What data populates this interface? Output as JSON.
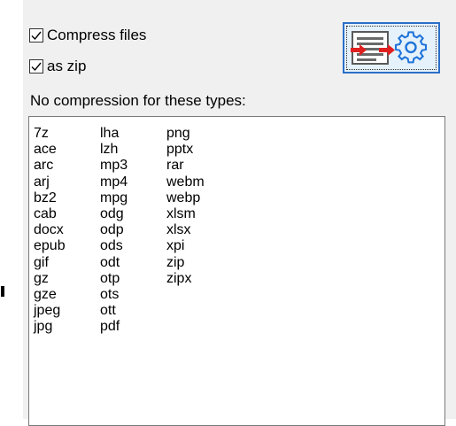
{
  "options": {
    "compress_files": {
      "label": "Compress files",
      "checked": true
    },
    "as_zip": {
      "label": "as zip",
      "checked": true
    }
  },
  "settings_button": {
    "icon": "edit-settings-gear-icon",
    "accent": "#2b6fc8"
  },
  "no_compression": {
    "label": "No compression for these types:",
    "columns": [
      [
        "7z",
        "ace",
        "arc",
        "arj",
        "bz2",
        "cab",
        "docx",
        "epub",
        "gif",
        "gz",
        "gze",
        "jpeg",
        "jpg"
      ],
      [
        "lha",
        "lzh",
        "mp3",
        "mp4",
        "mpg",
        "odg",
        "odp",
        "ods",
        "odt",
        "otp",
        "ots",
        "ott",
        "pdf"
      ],
      [
        "png",
        "pptx",
        "rar",
        "webm",
        "webp",
        "xlsm",
        "xlsx",
        "xpi",
        "zip",
        "zipx"
      ]
    ]
  }
}
